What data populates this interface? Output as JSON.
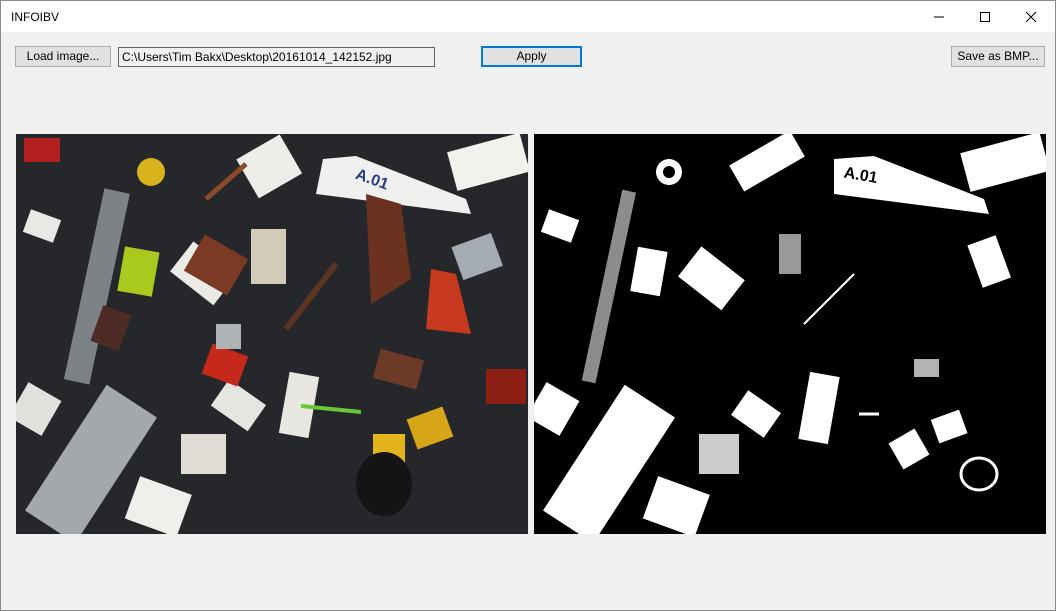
{
  "window": {
    "title": "INFOIBV"
  },
  "toolbar": {
    "load_label": "Load image...",
    "path_value": "C:\\Users\\Tim Bakx\\Desktop\\20161014_142152.jpg",
    "apply_label": "Apply",
    "save_label": "Save as BMP..."
  },
  "images": {
    "input_label": "",
    "output_label": ""
  },
  "colors": {
    "titlebar": "#ffffff",
    "window_bg": "#f0f0f0",
    "button_bg": "#e1e1e1",
    "accent": "#0078d7",
    "photo_bg": "#26272a",
    "threshold_bg": "#000000"
  },
  "icons": {
    "minimize": "minimize-icon",
    "maximize": "maximize-icon",
    "close": "close-icon"
  }
}
